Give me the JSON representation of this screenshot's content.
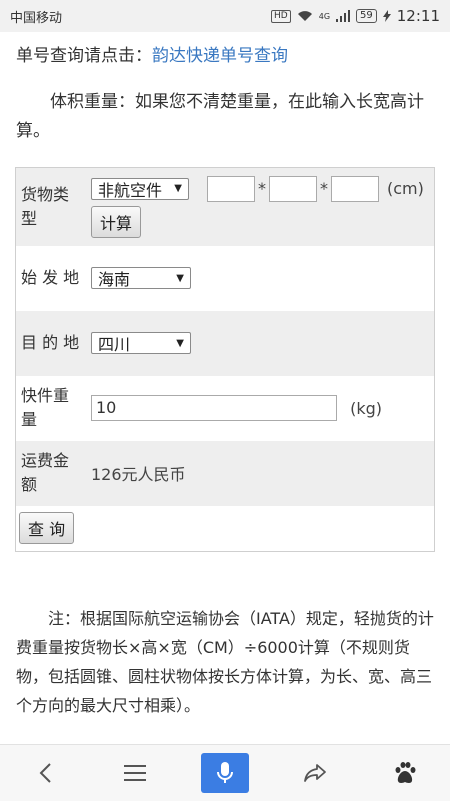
{
  "statusbar": {
    "carrier": "中国移动",
    "hd_badge": "HD",
    "network": "4G",
    "battery": "59",
    "time": "12:11"
  },
  "intro": {
    "query_prompt": "单号查询请点击：",
    "query_link": "韵达快递单号查询",
    "volume_text": "体积重量：如果您不清楚重量，在此输入长宽高计算。"
  },
  "form": {
    "cargo_type": {
      "label": "货物类型",
      "selected": "非航空件",
      "dim_separator": "*",
      "dim_unit": "(cm)",
      "calc_button": "计算"
    },
    "origin": {
      "label": "始 发 地",
      "selected": "海南"
    },
    "destination": {
      "label": "目 的 地",
      "selected": "四川"
    },
    "weight": {
      "label": "快件重量",
      "value": "10",
      "unit": "(kg)"
    },
    "fee": {
      "label": "运费金额",
      "value": "126元人民币"
    },
    "query_button": "查 询"
  },
  "note": "注：根据国际航空运输协会（IATA）规定，轻抛货的计费重量按货物长×高×宽（CM）÷6000计算（不规则货物，包括圆锥、圆柱状物体按长方体计算，为长、宽、高三个方向的最大尺寸相乘）。",
  "navbar": {
    "icons": [
      "back-icon",
      "menu-icon",
      "microphone-icon",
      "share-icon",
      "baidu-paw-icon"
    ],
    "accent": "#3b7de3"
  },
  "colors": {
    "link": "#3a78c1",
    "row_grey": "#eeeeee"
  }
}
